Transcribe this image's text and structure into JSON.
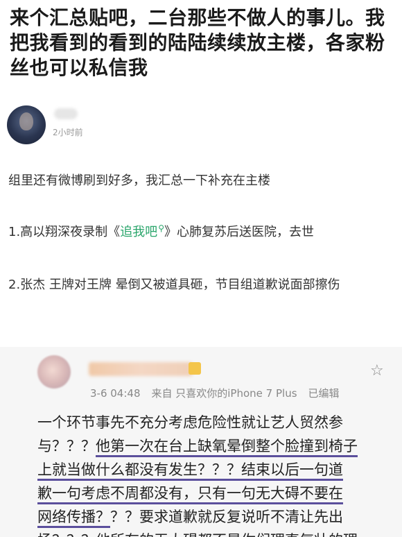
{
  "post": {
    "title": "来个汇总贴吧，二台那些不做人的事儿。我把我看到的看到的陆陆续续放主楼，各家粉丝也可以私信我",
    "time": "2小时前",
    "intro": "组里还有微博刷到好多，我汇总一下补充在主楼",
    "item1_pre": "1.高以翔深夜录制《",
    "item1_link": "追我吧",
    "item1_post": "》心肺复苏后送医院，去世",
    "item2": "2.张杰 王牌对王牌 晕倒又被道具砸，节目组道歉说面部擦伤"
  },
  "quote": {
    "date": "3-6 04:48",
    "source": "来自 只喜欢你的iPhone 7 Plus",
    "edited": "已编辑",
    "line1": "一个环节事先不充分考虑危险性就让艺人贸然参",
    "line2_a": "与？？？",
    "line2_b": "他第一次在台上缺氧晕倒整个脸撞到椅子",
    "line3_a": "上就当做什么都没有发生？？？结束以后一句道",
    "line4_a": "歉一句考虑不周都没有，只有一句无大碍不要在",
    "line5_a": "网络传播？",
    "line5_b": "？？要求道歉就反复说听不清让先出",
    "line6": "场？？？他所有的无大碍都不是你们理直气壮的理"
  }
}
